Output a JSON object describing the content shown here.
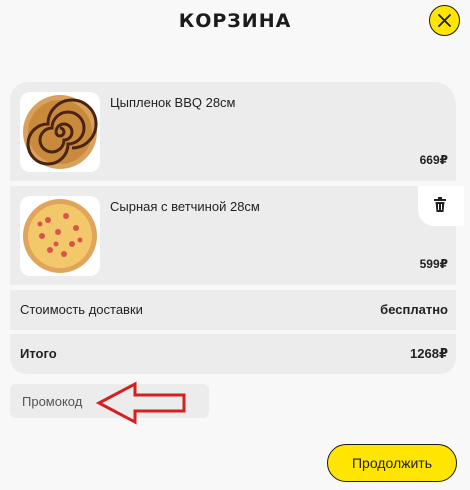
{
  "header": {
    "title": "КОРЗИНА"
  },
  "cart": {
    "items": [
      {
        "name": "Цыпленок BBQ 28см",
        "price": "669₽",
        "image_icon": "bbq-chicken-pizza"
      },
      {
        "name": "Сырная с ветчиной 28см",
        "price": "599₽",
        "image_icon": "cheese-ham-pizza"
      }
    ],
    "delivery": {
      "label": "Стоимость доставки",
      "value": "бесплатно"
    },
    "total": {
      "label": "Итого",
      "value": "1268₽"
    }
  },
  "promo": {
    "placeholder": "Промокод",
    "value": ""
  },
  "actions": {
    "continue_label": "Продолжить"
  },
  "icons": {
    "close": "close-icon",
    "delete": "trash-icon",
    "annotation": "red-arrow-icon"
  },
  "colors": {
    "accent": "#ffe500",
    "annotation": "#d42020"
  }
}
